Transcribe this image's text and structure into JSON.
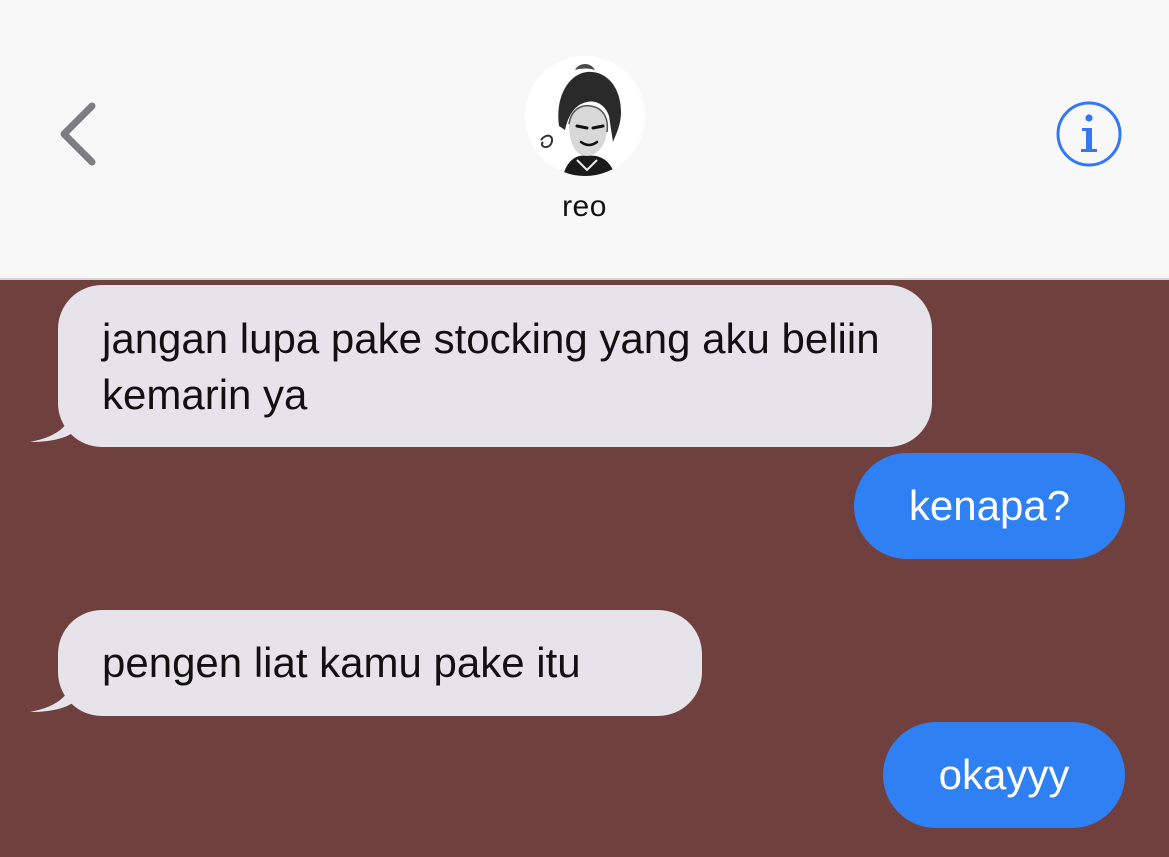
{
  "header": {
    "contact_name": "reo",
    "back_icon": "chevron-left-icon",
    "info_icon": "info-circle-icon",
    "accent_color": "#3478f6"
  },
  "thread": {
    "background_color": "#6f403d",
    "incoming_bubble_color": "#e6e4ea",
    "outgoing_bubble_color": "#2f80f2",
    "messages": [
      {
        "direction": "incoming",
        "text": "jangan lupa pake stocking yang aku beliin kemarin ya"
      },
      {
        "direction": "outgoing",
        "text": "kenapa?"
      },
      {
        "direction": "incoming",
        "text": "pengen liat kamu pake itu"
      },
      {
        "direction": "outgoing",
        "text": "okayyy"
      }
    ]
  }
}
